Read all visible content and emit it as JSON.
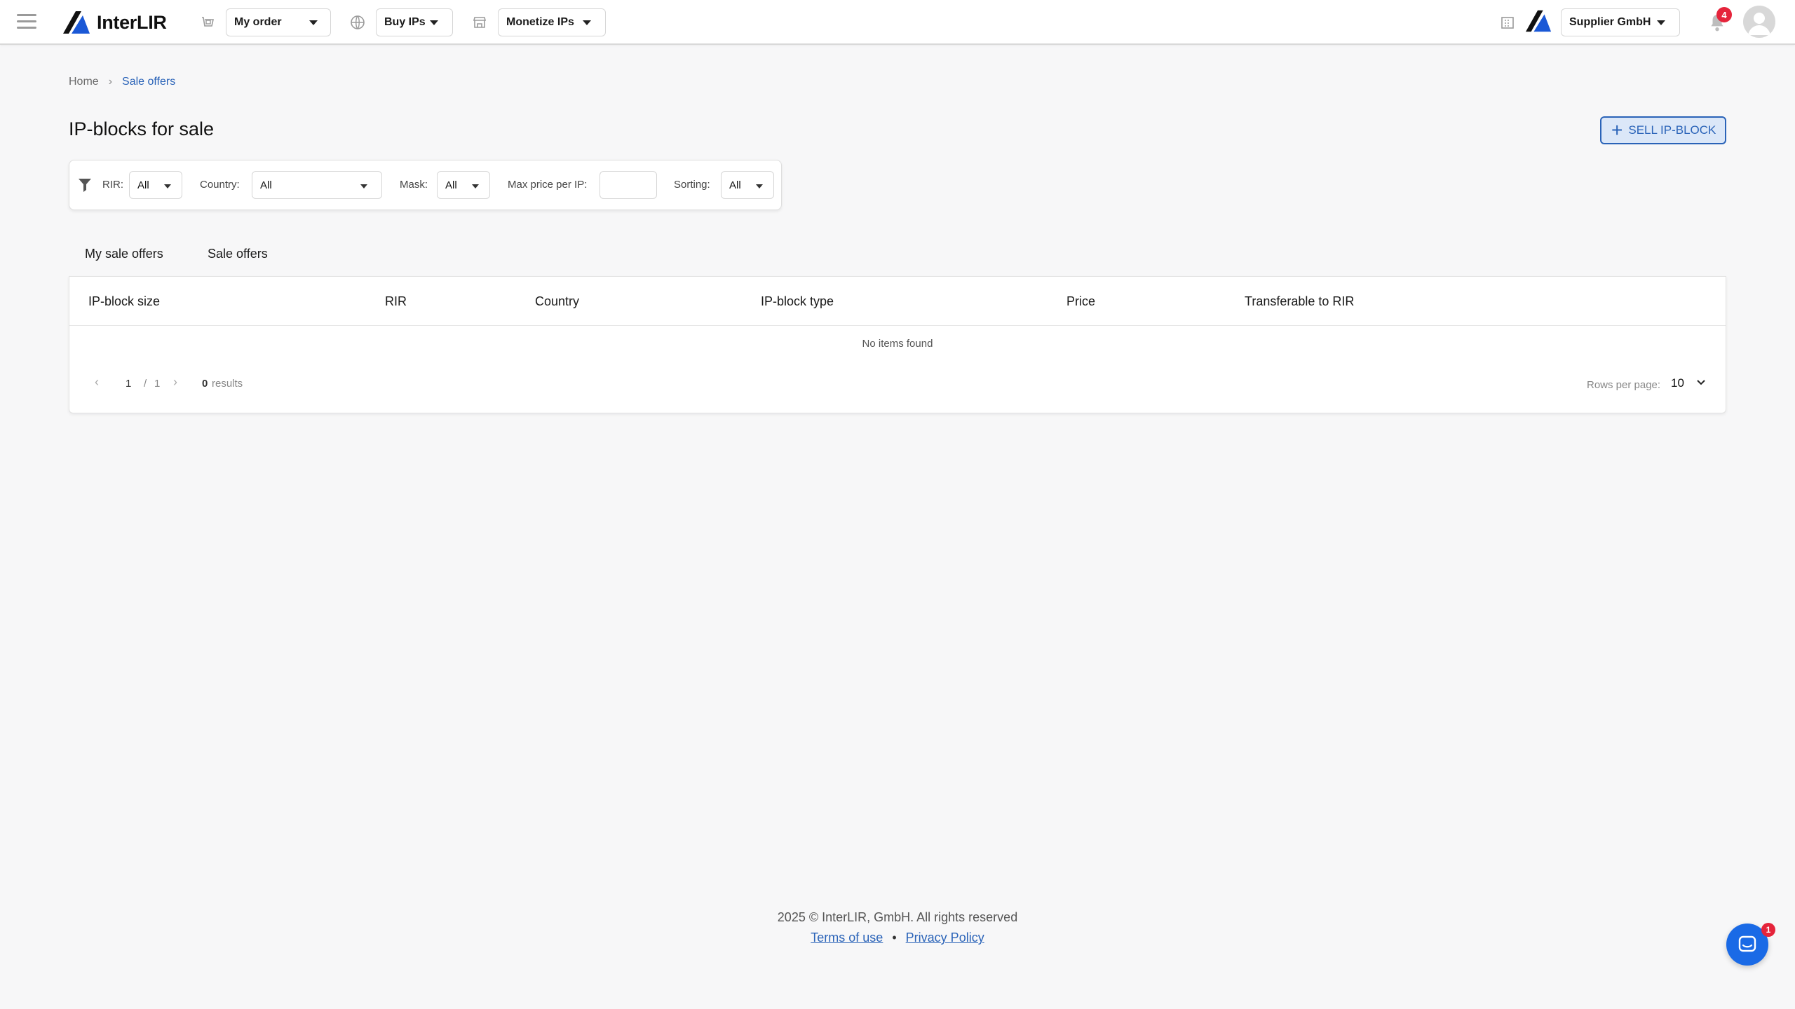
{
  "header": {
    "logo_text": "InterLIR",
    "nav": [
      {
        "label": "My order",
        "icon": "cart-icon"
      },
      {
        "label": "Buy IPs",
        "icon": "globe-icon"
      },
      {
        "label": "Monetize IPs",
        "icon": "store-icon"
      }
    ],
    "company": "Supplier GmbH",
    "notifications_count": "4",
    "colors": {
      "accent": "#2a63b8",
      "badge": "#e5243b"
    }
  },
  "breadcrumb": {
    "home": "Home",
    "separator": "›",
    "current": "Sale offers"
  },
  "page_title": "IP-blocks for sale",
  "sell_button": {
    "label": "SELL IP-BLOCK",
    "icon": "plus-icon"
  },
  "filters": {
    "rir_label": "RIR:",
    "rir_value": "All",
    "country_label": "Country:",
    "country_value": "All",
    "mask_label": "Mask:",
    "mask_value": "All",
    "max_price_label": "Max price per IP:",
    "max_price_value": "",
    "sorting_label": "Sorting:",
    "sorting_value": "All"
  },
  "tabs": [
    {
      "label": "My sale offers",
      "active": true
    },
    {
      "label": "Sale offers",
      "active": false
    }
  ],
  "table": {
    "columns": [
      "IP-block size",
      "RIR",
      "Country",
      "IP-block type",
      "Price",
      "Transferable to RIR"
    ],
    "empty_text": "No items found",
    "page_current": "1",
    "page_sep": "/",
    "page_total": "1",
    "results_count": "0",
    "results_label": "results",
    "rows_per_page_label": "Rows per page:",
    "rows_per_page_value": "10"
  },
  "footer": {
    "copyright": "2025 © InterLIR, GmbH. All rights reserved",
    "terms": "Terms of use",
    "bullet": "•",
    "privacy": "Privacy Policy"
  },
  "chat": {
    "badge": "1"
  }
}
